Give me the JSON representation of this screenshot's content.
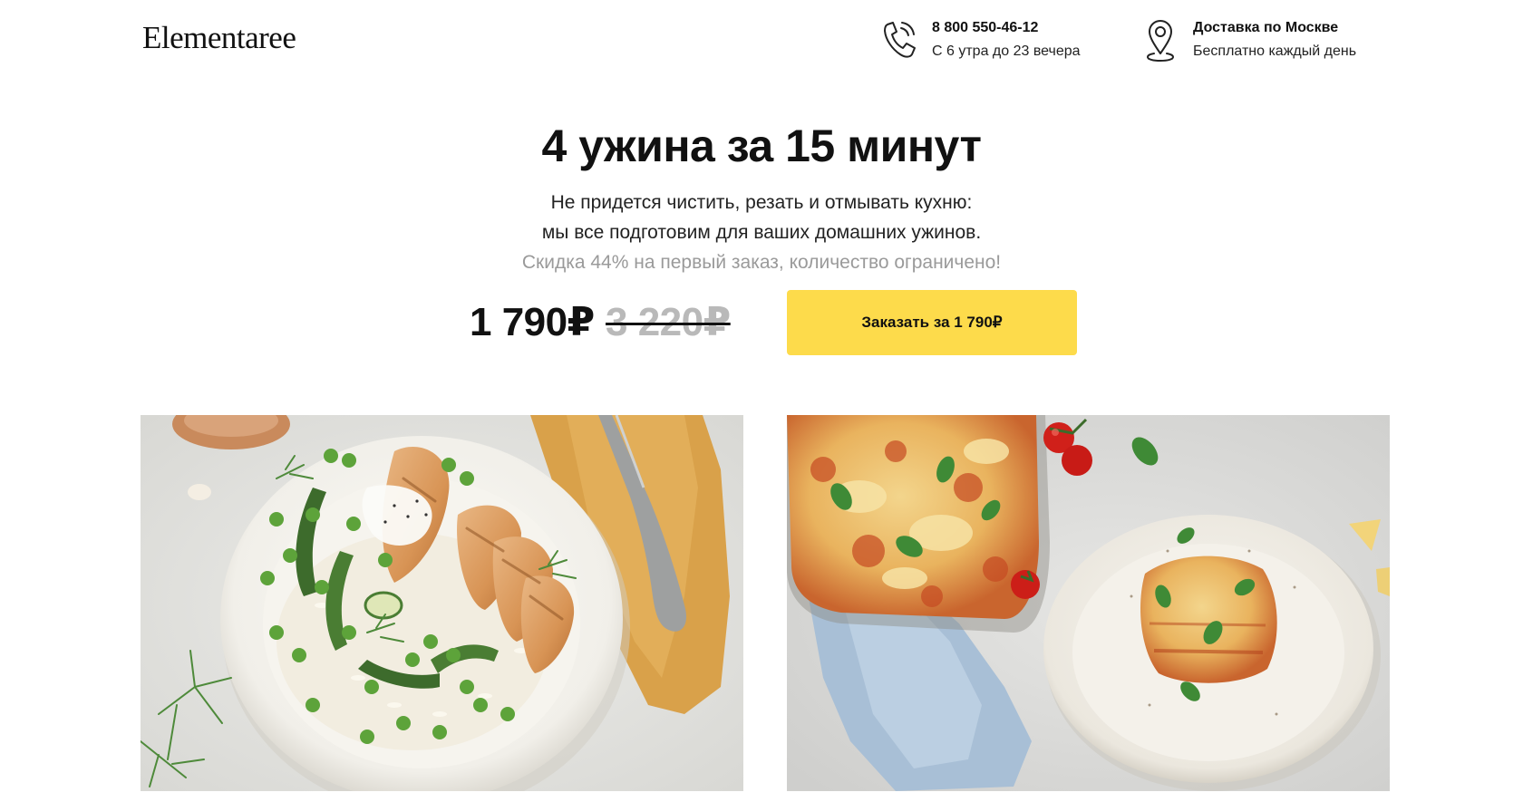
{
  "header": {
    "logo_text": "Elementaree",
    "phone": {
      "number": "8 800 550-46-12",
      "hours": "С 6 утра до 23 вечера",
      "icon": "phone-icon"
    },
    "delivery": {
      "title": "Доставка по Москве",
      "subtitle": "Бесплатно каждый день",
      "icon": "location-pin-icon"
    }
  },
  "hero": {
    "title": "4 ужина за 15 минут",
    "subtitle_line1": "Не придется чистить, резать и отмывать кухню:",
    "subtitle_line2": "мы все подготовим для ваших домашних ужинов.",
    "discount_note": "Скидка 44% на первый заказ, количество ограничено!"
  },
  "pricing": {
    "price": "1 790₽",
    "old_price": "3 220₽",
    "order_button_label": "Заказать за 1 790₽"
  },
  "colors": {
    "accent": "#fddb4b",
    "text": "#111111",
    "muted": "#9a9a9a"
  }
}
